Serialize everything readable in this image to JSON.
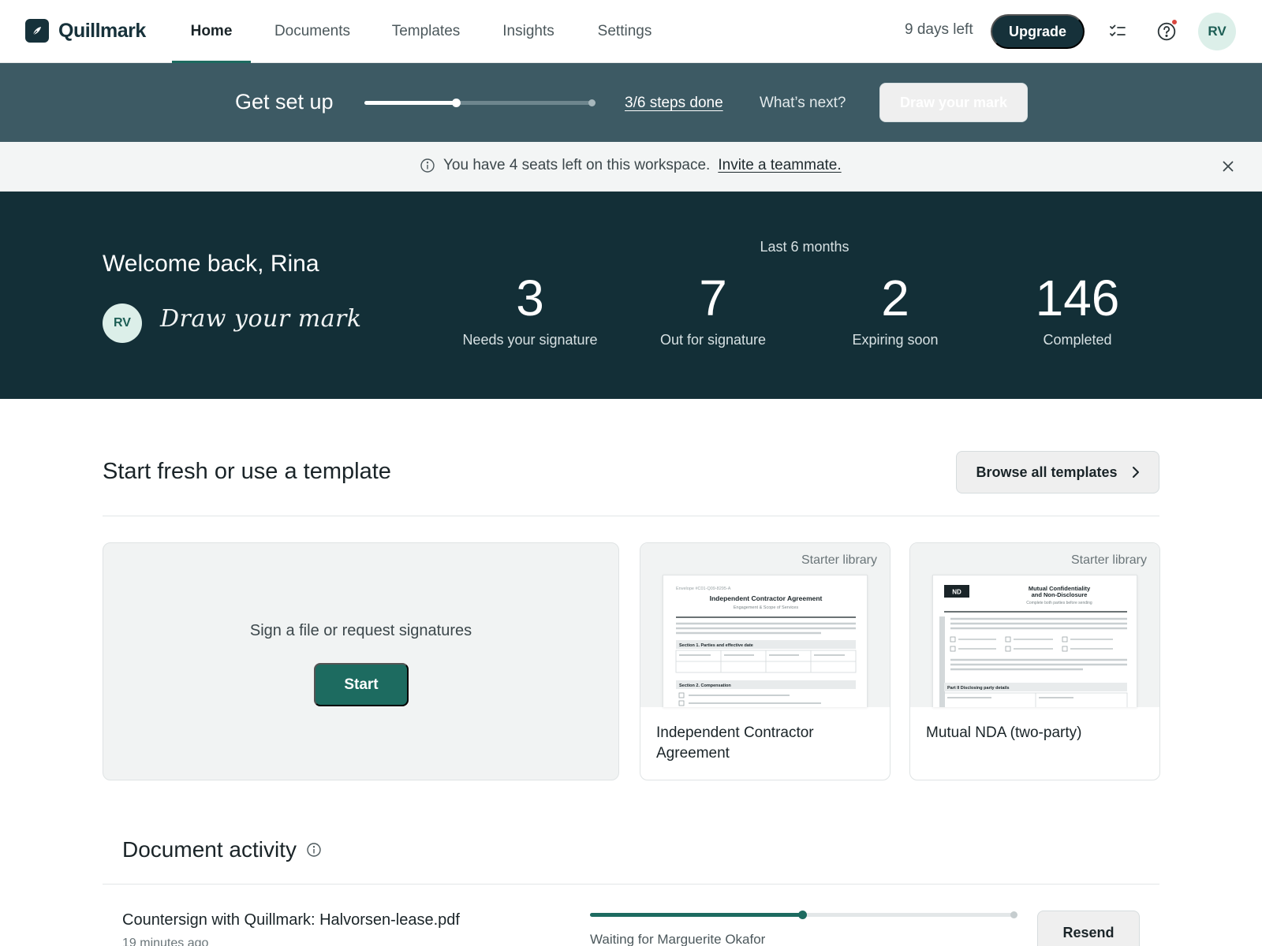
{
  "app": {
    "name": "Quillmark"
  },
  "nav": {
    "tabs": [
      {
        "label": "Home",
        "active": true
      },
      {
        "label": "Documents",
        "active": false
      },
      {
        "label": "Templates",
        "active": false
      },
      {
        "label": "Insights",
        "active": false
      },
      {
        "label": "Settings",
        "active": false
      }
    ],
    "trial_text": "9 days left",
    "upgrade_label": "Upgrade",
    "icons": [
      "tasks-icon",
      "help-icon"
    ],
    "avatar_initials": "RV"
  },
  "setup": {
    "title": "Get set up",
    "steps_done": 3,
    "steps_total": 6,
    "steps_label": "3/6 steps done",
    "whats_next": "What’s next?",
    "draw_button": "Draw your mark"
  },
  "notice": {
    "text": "You have 4 seats left on this workspace.",
    "link": "Invite a teammate."
  },
  "hero": {
    "welcome": "Welcome back, Rina",
    "avatar_initials": "RV",
    "signature_prompt": "Draw your mark",
    "period": "Last 6 months",
    "stats": [
      {
        "value": "3",
        "label": "Needs your signature"
      },
      {
        "value": "7",
        "label": "Out for signature"
      },
      {
        "value": "2",
        "label": "Expiring soon"
      },
      {
        "value": "146",
        "label": "Completed"
      }
    ]
  },
  "templates": {
    "title": "Start fresh or use a template",
    "browse_label": "Browse all templates",
    "start_card": {
      "text": "Sign a file or request signatures",
      "button": "Start"
    },
    "cards": [
      {
        "tag": "Starter library",
        "name": "Independent Contractor Agreement",
        "preview": {
          "ref": "Envelope #C01-Q09-8295-A",
          "title": "Independent Contractor Agreement",
          "subtitle": "Engagement & Scope of Services",
          "section1": "Section 1. Parties and effective date",
          "section2": "Section 2. Compensation"
        }
      },
      {
        "tag": "Starter library",
        "name": "Mutual NDA (two-party)",
        "preview": {
          "badge": "ND",
          "title1": "Mutual Confidentiality",
          "title2": "and Non-Disclosure",
          "subtitle": "Complete both parties before sending",
          "section1": "Part II Disclosing party details"
        }
      }
    ]
  },
  "activity": {
    "title": "Document activity",
    "rows": [
      {
        "title": "Countersign with Quillmark: Halvorsen-lease.pdf",
        "time": "19 minutes ago",
        "progress": 0.5,
        "status": "Waiting for Marguerite Okafor",
        "action": "Resend"
      }
    ]
  },
  "colors": {
    "brand": "#16313a",
    "accent": "#1d6b60",
    "setup_bar": "#3d5a64",
    "hero": "#132f37",
    "notification": "#d9473f"
  }
}
